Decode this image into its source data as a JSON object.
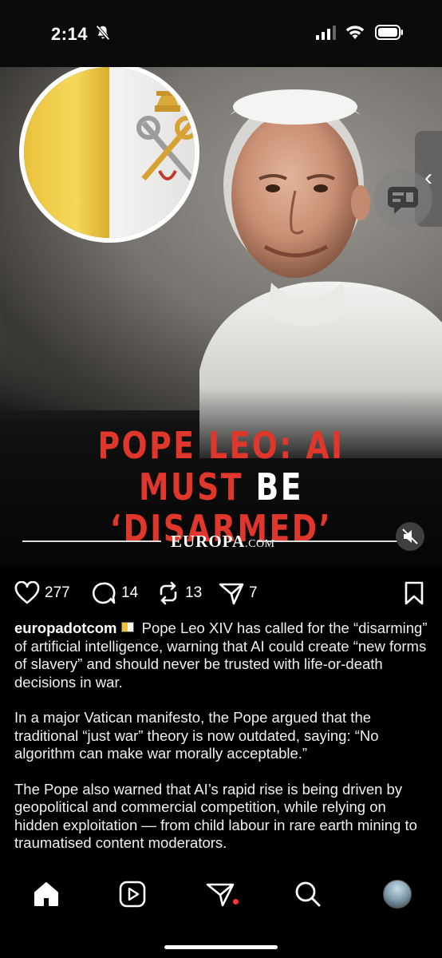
{
  "status_bar": {
    "time": "2:14"
  },
  "post": {
    "headline_line1": "POPE LEO: AI",
    "headline_line2_a": "MUST",
    "headline_line2_b": "BE",
    "headline_line2_c": "‘DISARMED’",
    "brand_main": "EUROPA",
    "brand_suffix": ".COM",
    "likes": "277",
    "comments": "14",
    "reposts": "13",
    "shares": "7",
    "username": "europadotcom",
    "caption_p1": "Pope Leo XIV has called for the “disarming” of artificial intelligence, warning that AI could create “new forms of slavery” and should never be trusted with life-or-death decisions in war.",
    "caption_p2": "In a major Vatican manifesto, the Pope argued that the traditional “just war” theory is now outdated, saying: “No algorithm can make war morally acceptable.”",
    "caption_p3": "The Pope also warned that AI’s rapid rise is being driven by geopolitical and commercial competition, while relying on hidden exploitation — from child labour in rare earth mining to traumatised content moderators."
  },
  "colors": {
    "headline_red": "#e0372c",
    "notification_dot": "#ff3040"
  },
  "icons": [
    "bell-slash-icon",
    "signal-icon",
    "wifi-icon",
    "battery-icon",
    "heart-icon",
    "comment-icon",
    "repost-icon",
    "share-icon",
    "bookmark-icon",
    "mute-icon",
    "home-icon",
    "reels-icon",
    "send-icon",
    "search-icon",
    "profile-avatar"
  ]
}
